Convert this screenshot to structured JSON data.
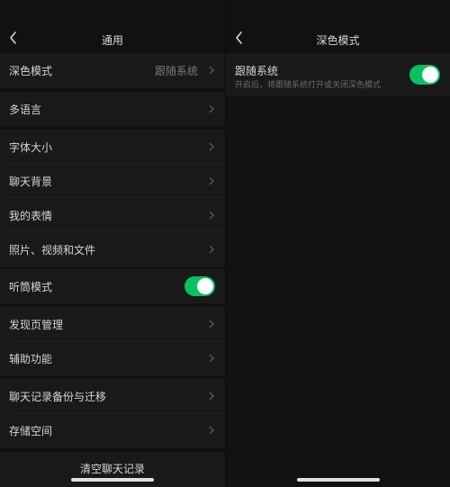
{
  "general": {
    "title": "通用",
    "dark_mode": {
      "label": "深色模式",
      "value": "跟随系统"
    },
    "language": {
      "label": "多语言"
    },
    "font_size": {
      "label": "字体大小"
    },
    "chat_background": {
      "label": "聊天背景"
    },
    "my_stickers": {
      "label": "我的表情"
    },
    "media_files": {
      "label": "照片、视频和文件"
    },
    "earpiece_mode": {
      "label": "听筒模式",
      "toggle_on": true
    },
    "discover_manage": {
      "label": "发现页管理"
    },
    "accessibility": {
      "label": "辅助功能"
    },
    "chat_backup": {
      "label": "聊天记录备份与迁移"
    },
    "storage": {
      "label": "存储空间"
    },
    "clear_history": "清空聊天记录"
  },
  "dark_mode_page": {
    "title": "深色模式",
    "follow_system": {
      "label": "跟随系统",
      "description": "开启后，将跟随系统打开或关闭深色模式",
      "toggle_on": true
    }
  },
  "icons": [
    "back-icon",
    "chevron-right-icon"
  ],
  "colors": {
    "background": "#111111",
    "cell": "#191919",
    "accent": "#07c160"
  }
}
